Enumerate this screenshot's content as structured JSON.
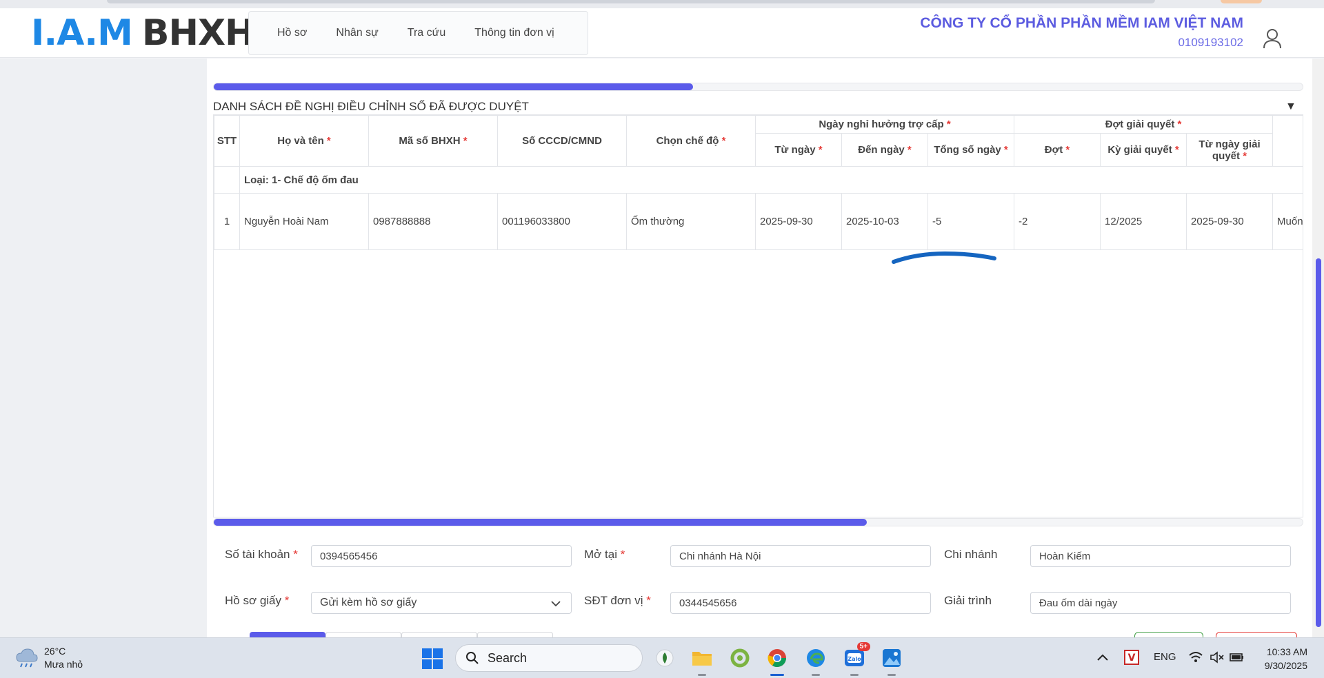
{
  "logo": {
    "iam": "I.A.M",
    "bhxh": "BHXH"
  },
  "nav": {
    "items": [
      "Hồ sơ",
      "Nhân sự",
      "Tra cứu",
      "Thông tin đơn vị"
    ]
  },
  "company": {
    "name": "CÔNG TY CỔ PHẦN PHẦN MỀM IAM VIỆT NAM",
    "tax_code": "0109193102"
  },
  "scrollbars": {
    "top_progress": 0.44,
    "table_progress": 0.6
  },
  "section": {
    "title": "DANH SÁCH ĐỀ NGHỊ ĐIỀU CHỈNH SỐ ĐÃ ĐƯỢC DUYỆT",
    "collapse_icon": "▼"
  },
  "table": {
    "headers": {
      "stt": "STT",
      "name": "Họ và tên",
      "bhxh": "Mã số BHXH",
      "cccd": "Số CCCD/CMND",
      "mode": "Chọn chế độ",
      "leave_group": "Ngày nghỉ hưởng trợ cấp",
      "from": "Từ ngày",
      "to": "Đến ngày",
      "total": "Tổng số ngày",
      "batch_group": "Đợt giải quyết",
      "batch": "Đợt",
      "period": "Kỳ giải quyết",
      "resolve_from": "Từ ngày giải quyết",
      "required_mark": "*"
    },
    "group_label": "Loại: 1- Chế độ ốm đau",
    "rows": [
      {
        "stt": "1",
        "name": "Nguyễn Hoài Nam",
        "bhxh": "0987888888",
        "cccd": "001196033800",
        "mode": "Ốm thường",
        "from": "2025-09-30",
        "to": "2025-10-03",
        "total": "-5",
        "batch": "-2",
        "period": "12/2025",
        "resolve_from": "2025-09-30",
        "extra": "Muốn"
      }
    ]
  },
  "form": {
    "account_label": "Số tài khoản",
    "account_value": "0394565456",
    "open_at_label": "Mở tại",
    "open_at_value": "Chi nhánh Hà Nội",
    "branch_label": "Chi nhánh",
    "branch_value": "Hoàn Kiếm",
    "paper_label": "Hồ sơ giấy",
    "paper_value": "Gửi kèm hồ sơ giấy",
    "phone_label": "SĐT đơn vị",
    "phone_value": "0344545656",
    "explain_label": "Giải trình",
    "explain_value": "Đau ốm dài ngày",
    "required_mark": "*"
  },
  "taskbar": {
    "temperature": "26°C",
    "weather": "Mưa nhỏ",
    "search": "Search",
    "zalo_badge": "5+",
    "language": "ENG",
    "time": "10:33 AM",
    "date": "9/30/2025"
  },
  "colors": {
    "accent": "#5b5bea",
    "brand_blue": "#1e88e5",
    "required": "#e53935"
  }
}
